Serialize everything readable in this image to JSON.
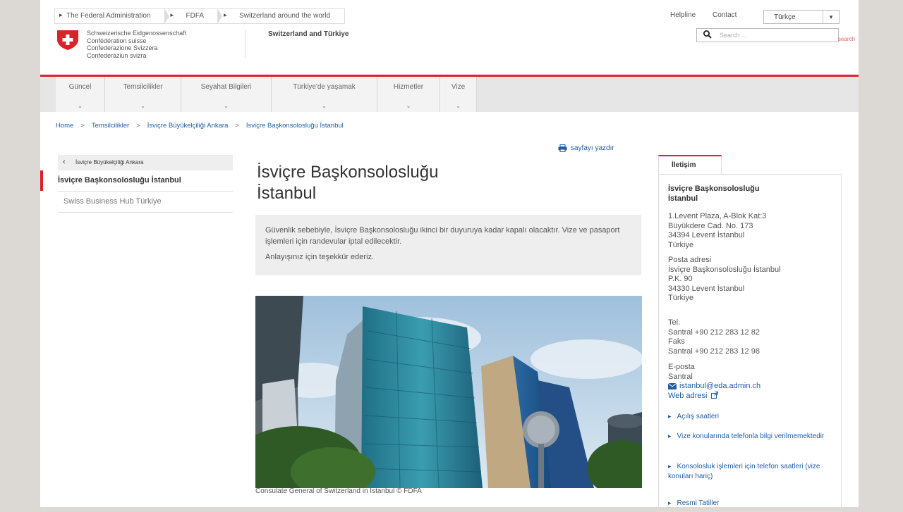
{
  "header": {
    "top_nav": [
      "The Federal Administration",
      "FDFA",
      "Switzerland around the world"
    ],
    "helpline": "Helpline",
    "contact": "Contact",
    "language": "Türkçe",
    "search_placeholder": "Search ...",
    "search_button": "search",
    "confederation_lines": [
      "Schweizerische Eidgenossenschaft",
      "Confédération suisse",
      "Confederazione Svizzera",
      "Confederaziun svizra"
    ],
    "site_title": "Switzerland and Türkiye"
  },
  "main_nav": [
    {
      "label": "Güncel",
      "chev": "⌄"
    },
    {
      "label": "Temsilcilikler",
      "chev": "⌄"
    },
    {
      "label": "Seyahat Bilgileri",
      "chev": "⌄"
    },
    {
      "label": "Türkiye'de yaşamak",
      "chev": "⌄"
    },
    {
      "label": "Hizmetler",
      "chev": "⌄"
    },
    {
      "label": "Vize",
      "chev": "⌄"
    }
  ],
  "breadcrumb": [
    "Home",
    "Temsilcilikler",
    "İsviçre Büyükelçiliği Ankara",
    "İsviçre Başkonsolosluğu İstanbul"
  ],
  "breadcrumb_sep": ">",
  "subnav": {
    "back": "İsviçre Büyükelçiliği Ankara",
    "active": "İsviçre Başkonsolosluğu İstanbul",
    "items": [
      "Swiss Business Hub Türkiye"
    ]
  },
  "content": {
    "print_label": "sayfayı yazdır",
    "title_line1": "İsviçre Başkonsolosluğu",
    "title_line2": "İstanbul",
    "notice_p1": "Güvenlik sebebiyle, İsviçre Başkonsolosluğu ikinci bir duyuruya kadar kapalı olacaktır. Vize ve pasaport işlemleri için randevular iptal edilecektir.",
    "notice_p2": "Anlayışınız için teşekkür ederiz.",
    "caption": "Consulate General of Switzerland in Istanbul © FDFA"
  },
  "contact": {
    "tab": "İletişim",
    "name_line1": "İsviçre Başkonsolosluğu",
    "name_line2": "İstanbul",
    "address": [
      "1.Levent Plaza, A-Blok Kat:3",
      "Büyükdere Cad. No. 173",
      "34394 Levent İstanbul",
      "Türkiye"
    ],
    "postal_label": "Posta adresi",
    "postal": [
      "İsviçre Başkonsolosluğu İstanbul",
      "P.K. 90",
      "34330 Levent İstanbul",
      "Türkiye"
    ],
    "tel_label": "Tel.",
    "tel": "Santral +90 212 283 12 82",
    "fax_label": "Faks",
    "fax": "Santral +90 212 283 12 98",
    "email_label": "E-posta",
    "email_sub": "Santral",
    "email": "istanbul@eda.admin.ch",
    "web": "Web adresi",
    "links": [
      "Açılış saatleri",
      "Vize konularında telefonla bilgi verilmemektedir",
      "Konsolosluk işlemleri için telefon saatleri (vize konuları hariç)",
      "Resmi Tatiller"
    ]
  },
  "colors": {
    "accent": "#d8232a",
    "link": "#1f5da6",
    "nav_bg": "#e6e6e6"
  }
}
